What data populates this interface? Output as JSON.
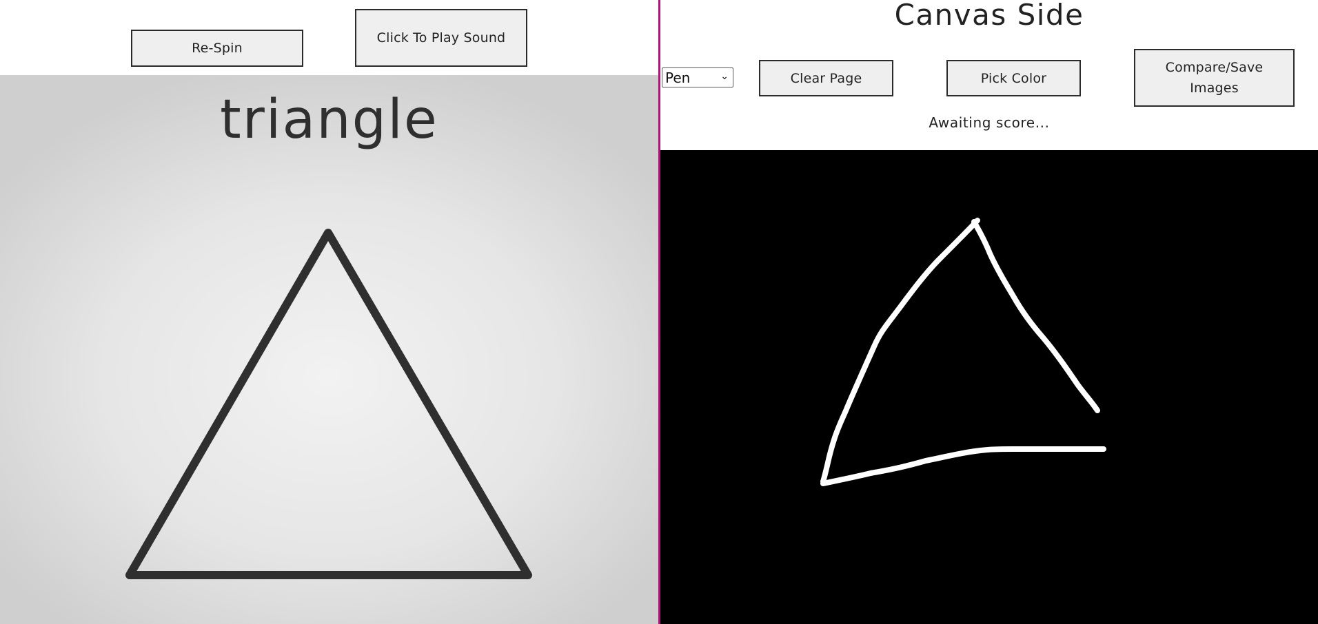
{
  "left": {
    "respin_label": "Re-Spin",
    "play_sound_label": "Click To Play Sound",
    "shape_name": "triangle",
    "reference_shape_icon": "triangle-outline"
  },
  "right": {
    "title": "Canvas Side",
    "tool_select": {
      "selected": "Pen",
      "icon": "chevron-down-icon"
    },
    "clear_label": "Clear Page",
    "pick_color_label": "Pick Color",
    "compare_label": "Compare/Save Images",
    "score_status": "Awaiting score...",
    "canvas_drawing": "hand-drawn-triangle"
  },
  "colors": {
    "divider": "#b0127a",
    "canvas_background": "#000000",
    "stroke_reference": "#2f2f2f",
    "stroke_drawing": "#ffffff",
    "button_background": "#efefef"
  }
}
